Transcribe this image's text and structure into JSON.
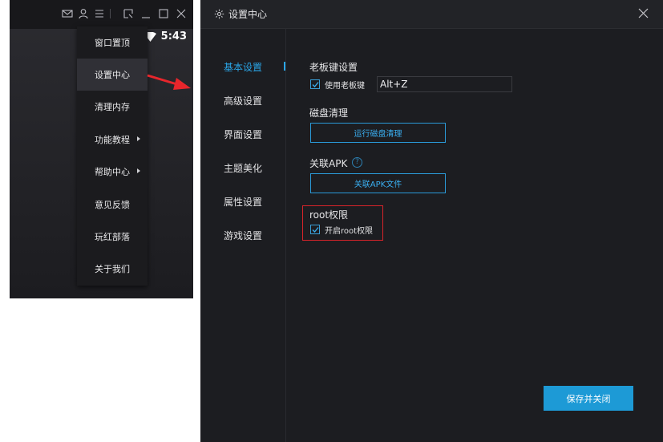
{
  "emulator": {
    "topbar_icons": [
      "mail-icon",
      "user-icon",
      "menu-icon",
      "screenshot-icon",
      "minimize-icon",
      "maximize-icon",
      "close-icon"
    ],
    "status_time": "5:43",
    "menu_items": [
      {
        "label": "窗口置顶",
        "submenu": false
      },
      {
        "label": "设置中心",
        "submenu": false,
        "active": true
      },
      {
        "label": "清理内存",
        "submenu": false
      },
      {
        "label": "功能教程",
        "submenu": true
      },
      {
        "label": "帮助中心",
        "submenu": true
      },
      {
        "label": "意见反馈",
        "submenu": false
      },
      {
        "label": "玩红部落",
        "submenu": false
      },
      {
        "label": "关于我们",
        "submenu": false
      }
    ]
  },
  "dialog": {
    "title": "设置中心",
    "nav": [
      {
        "label": "基本设置",
        "active": true
      },
      {
        "label": "高级设置"
      },
      {
        "label": "界面设置"
      },
      {
        "label": "主题美化"
      },
      {
        "label": "属性设置"
      },
      {
        "label": "游戏设置"
      }
    ],
    "boss_key": {
      "title": "老板键设置",
      "checkbox_label": "使用老板键",
      "checked": true,
      "value": "Alt+Z"
    },
    "disk": {
      "title": "磁盘清理",
      "button": "运行磁盘清理"
    },
    "apk": {
      "title": "关联APK",
      "help": "?",
      "button": "关联APK文件"
    },
    "root": {
      "title": "root权限",
      "checkbox_label": "开启root权限",
      "checked": true
    },
    "save_button": "保存并关闭"
  },
  "colors": {
    "accent": "#2aa6e8",
    "highlight_box": "#d8232a",
    "save_button": "#1d9ad6"
  }
}
